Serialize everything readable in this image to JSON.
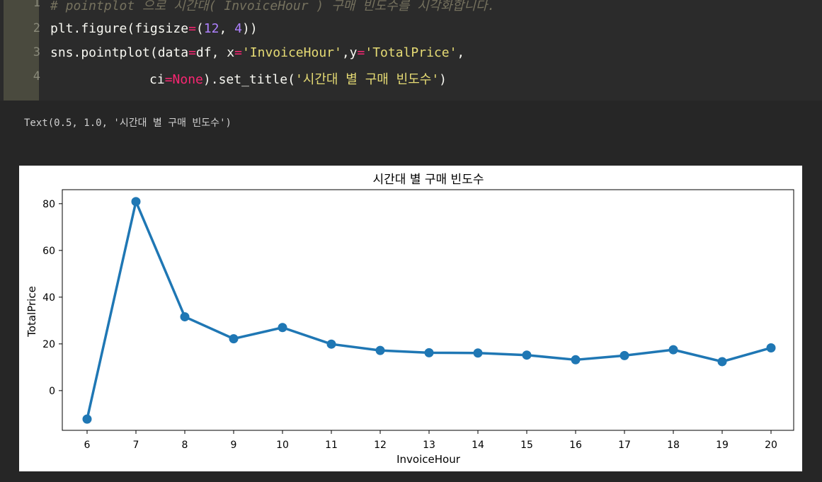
{
  "notebook": {
    "code_lines": [
      {
        "num": "1"
      },
      {
        "num": "2"
      },
      {
        "num": "3"
      },
      {
        "num": "4"
      }
    ],
    "comment": "# pointplot 으로 시간대( InvoiceHour ) 구매 빈도수를 시각화합니다.",
    "line2": {
      "a": "plt.figure(figsize",
      "eq": "=",
      "p1": "(",
      "n1": "12",
      "c": ", ",
      "n2": "4",
      "p2": "))"
    },
    "line3": {
      "a": "sns.pointplot(data",
      "eq1": "=",
      "b": "df, x",
      "eq2": "=",
      "s1": "'InvoiceHour'",
      "c": ",y",
      "eq3": "=",
      "s2": "'TotalPrice'",
      "d": ","
    },
    "line4": {
      "a": "ci",
      "eq": "=",
      "kw": "None",
      "b": ").set_title(",
      "s": "'시간대 별 구매 빈도수'",
      "c": ")"
    },
    "output_text": "Text(0.5, 1.0, '시간대 별 구매 빈도수')"
  },
  "chart_data": {
    "type": "line",
    "title": "시간대 별 구매 빈도수",
    "xlabel": "InvoiceHour",
    "ylabel": "TotalPrice",
    "categories": [
      "6",
      "7",
      "8",
      "9",
      "10",
      "11",
      "12",
      "13",
      "14",
      "15",
      "16",
      "17",
      "18",
      "19",
      "20"
    ],
    "values": [
      -12.2,
      80.9,
      31.6,
      22.2,
      27.0,
      19.9,
      17.2,
      16.2,
      16.1,
      15.2,
      13.2,
      15.0,
      17.5,
      12.4,
      18.3
    ],
    "yticks": [
      0,
      20,
      40,
      60,
      80
    ],
    "ylim": [
      -17,
      86
    ],
    "grid": false,
    "color": "#1f77b4"
  }
}
